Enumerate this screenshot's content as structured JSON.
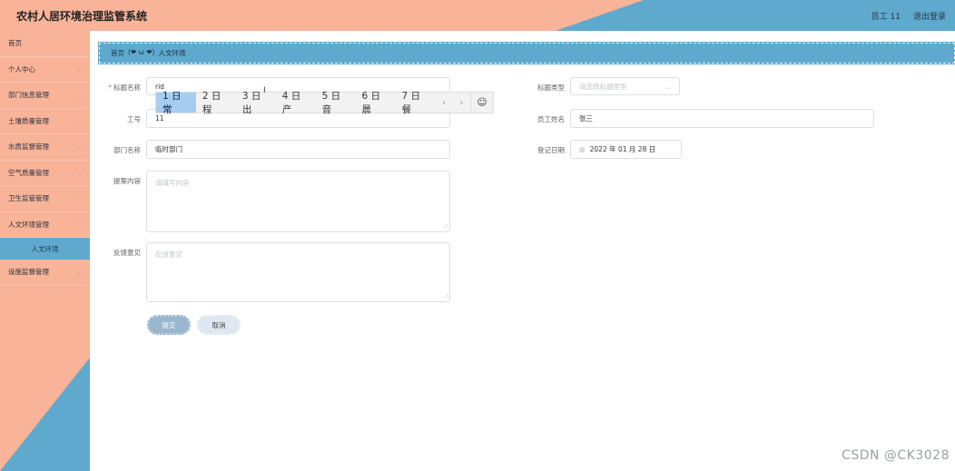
{
  "app": {
    "title": "农村人居环境治理监管系统"
  },
  "header": {
    "user_label": "员工 11",
    "logout_label": "退出登录"
  },
  "sidebar": {
    "items": [
      {
        "label": "首页",
        "has_chevron": false
      },
      {
        "label": "个人中心",
        "has_chevron": true
      },
      {
        "label": "部门信息管理",
        "has_chevron": true
      },
      {
        "label": "土壤质量管理",
        "has_chevron": true
      },
      {
        "label": "水质监督管理",
        "has_chevron": true
      },
      {
        "label": "空气质量管理",
        "has_chevron": true
      },
      {
        "label": "卫生监管管理",
        "has_chevron": true
      },
      {
        "label": "人文环境管理",
        "has_chevron": true
      },
      {
        "label": "人文环境",
        "has_chevron": false,
        "active": true
      },
      {
        "label": "设施监督管理",
        "has_chevron": true
      }
    ]
  },
  "breadcrumb": {
    "home": "首页",
    "separator": "(❤ ω ❤)",
    "current": "人文环境"
  },
  "form": {
    "title_label": "标题名称",
    "title_value": "rid",
    "type_label": "标题类型",
    "type_placeholder": "请选择标题类型",
    "job_no_label": "工号",
    "job_no_value": "11",
    "emp_name_label": "员工姓名",
    "emp_name_value": "张三",
    "dept_label": "部门名称",
    "dept_value": "临时部门",
    "date_label": "登记日期",
    "date_value": "2022 年 01 月 28 日",
    "content_label": "提案内容",
    "content_placeholder": "请填写内容",
    "feedback_label": "反馈意见",
    "feedback_placeholder": "反馈意见",
    "submit_label": "提交",
    "cancel_label": "取消"
  },
  "ime": {
    "candidates": [
      "1 日常",
      "2 日程",
      "3 日出",
      "4 日产",
      "5 日音",
      "6 日晨",
      "7 日餐"
    ],
    "prev": "‹",
    "next": "›",
    "emoji": "☺"
  },
  "watermark": "CSDN @CK3028"
}
